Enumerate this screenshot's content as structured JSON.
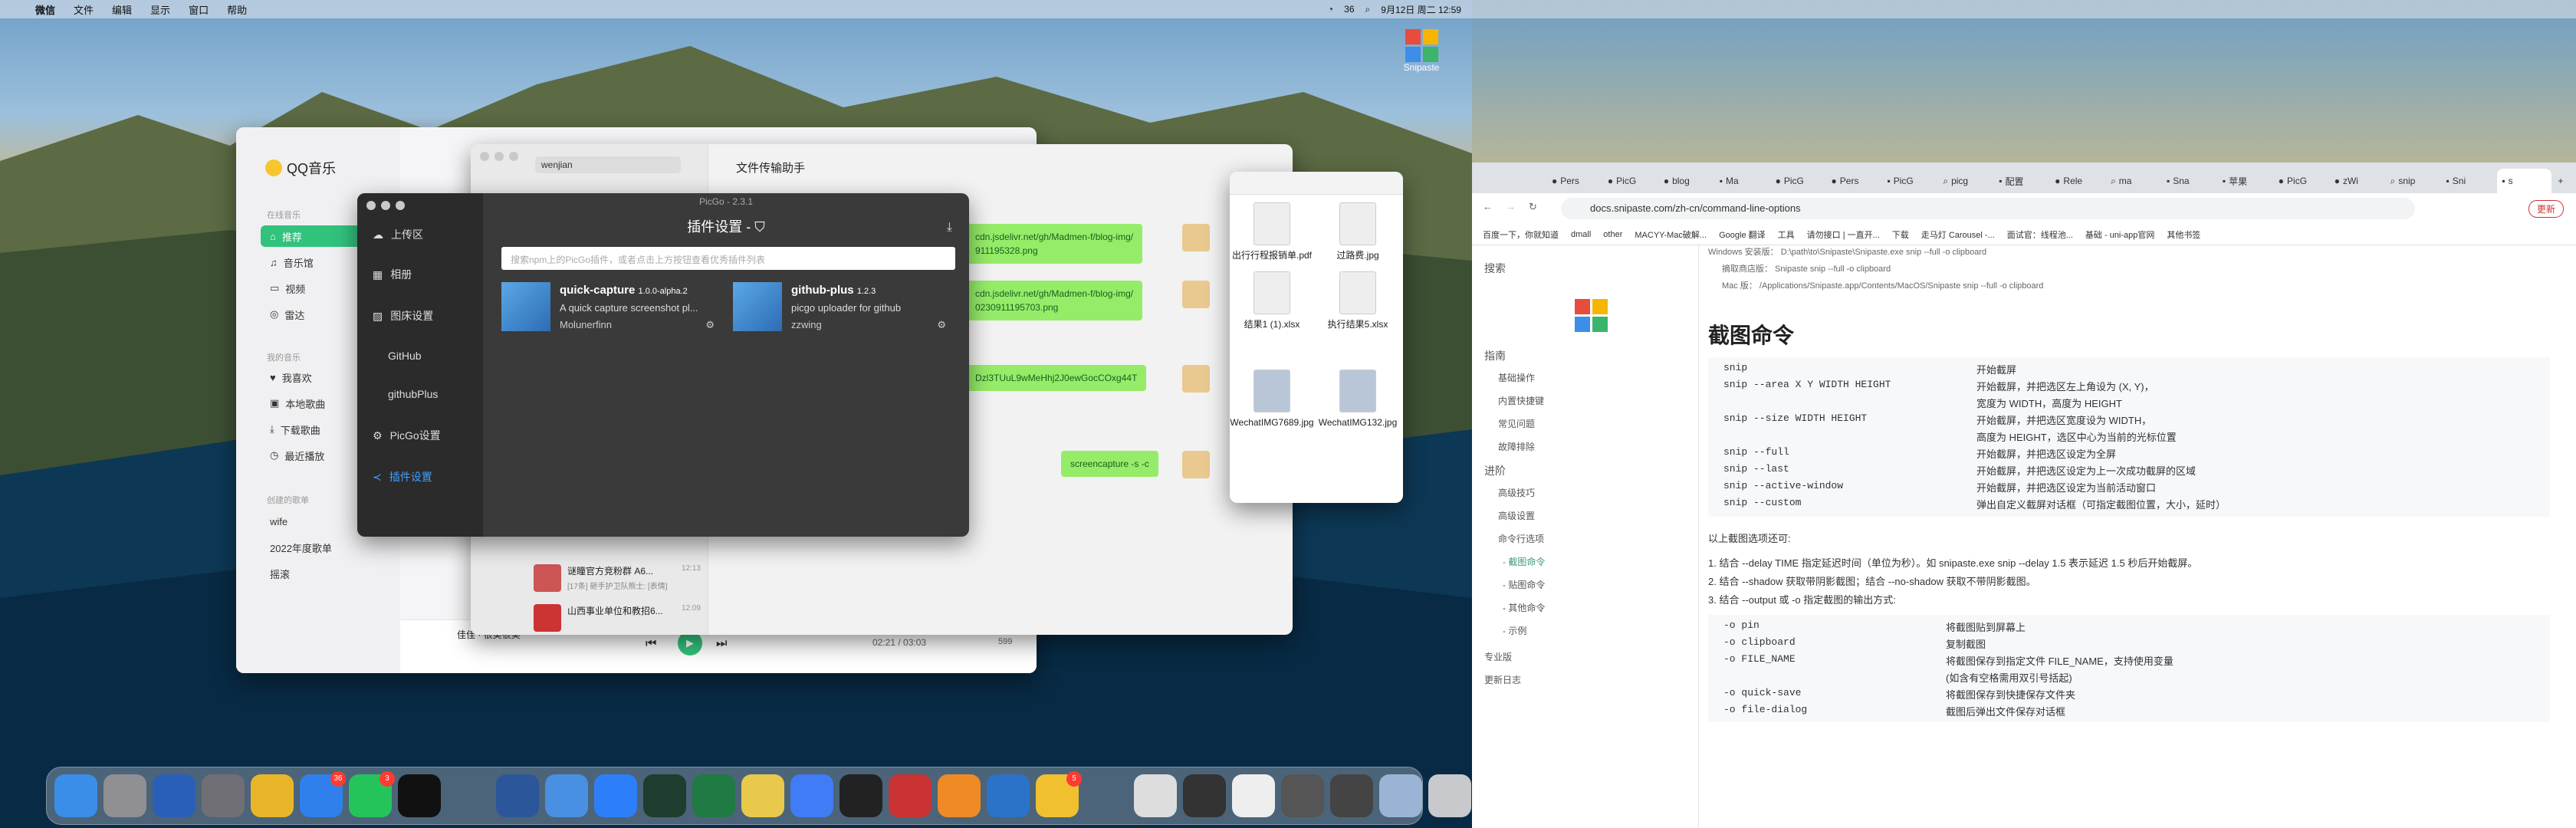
{
  "left_menubar": {
    "app": "微信",
    "items": [
      "文件",
      "编辑",
      "显示",
      "窗口",
      "帮助"
    ],
    "battery": "36",
    "clock": "9月12日 周二 12:59"
  },
  "qq_music": {
    "logo": "QQ音乐",
    "sec_online": "在线音乐",
    "recommend": "推荐",
    "library": "音乐馆",
    "video": "视频",
    "radio": "雷达",
    "sec_mine": "我的音乐",
    "liked": "我喜欢",
    "local": "本地歌曲",
    "downloads": "下载歌曲",
    "recent": "最近播放",
    "sec_created": "创建的歌单",
    "pl1": "wife",
    "pl2": "2022年度歌单",
    "pl3": "摇滚",
    "now_playing": "佳佳 · 很美很美",
    "time": "02:21 / 03:03",
    "count": "599"
  },
  "file_transfer": {
    "title": "文件传输助手",
    "search": "wenjian",
    "msg1": "cdn.jsdelivr.net/gh/Madmen-f/blog-img/\n911195328.png",
    "msg2": "cdn.jsdelivr.net/gh/Madmen-f/blog-img/\n0230911195703.png",
    "msg3": "Dzl3TUuL9wMeHhj2J0ewGocCOxg44T",
    "msg4": "screencapture -s -c",
    "row1": "谜瞳官方竞粉群 A6...",
    "row1sub": "[17条] 砸手护卫队熊士: [表情]",
    "row1time": "12:13",
    "row2": "山西事业单位和教招6...",
    "row2time": "12:09"
  },
  "picgo": {
    "window_title": "PicGo - 2.3.1",
    "nav": [
      "上传区",
      "相册",
      "图床设置",
      "GitHub",
      "githubPlus",
      "PicGo设置",
      "插件设置"
    ],
    "header": "插件设置 -",
    "search_placeholder": "搜索npm上的PicGo插件，或者点击上方按钮查看优秀插件列表",
    "plugins": [
      {
        "name": "quick-capture",
        "version": "1.0.0-alpha.2",
        "desc": "A quick capture screenshot pl...",
        "author": "Molunerfinn"
      },
      {
        "name": "github-plus",
        "version": "1.2.3",
        "desc": "picgo uploader for github",
        "author": "zzwing"
      }
    ]
  },
  "finder": {
    "items": [
      "出行行程报销单.pdf",
      "过路费.jpg",
      "结果1 (1).xlsx",
      "执行结果5.xlsx",
      "WechatIMG7689.jpg",
      "WechatIMG132.jpg"
    ]
  },
  "snipaste_label": "Snipaste",
  "dock_badges": [
    "36",
    "3",
    "5"
  ],
  "browser": {
    "tabs": [
      "Pers",
      "PicG",
      "blog",
      "Ma",
      "PicG",
      "Pers",
      "PicG",
      "picg",
      "配置",
      "Rele",
      "ma",
      "Sna",
      "苹果",
      "PicG",
      "zWi",
      "snip",
      "Sni",
      "s"
    ],
    "url": "docs.snipaste.com/zh-cn/command-line-options",
    "bookmarks": [
      "百度一下，你就知道",
      "dmall",
      "other",
      "MACYY-Mac破解...",
      "Google 翻译",
      "工具",
      "请勿接口 | 一直开...",
      "下载",
      "走马灯 Carousel -...",
      "面试官：线程池...",
      "基础 - uni-app官网",
      "其他书签"
    ],
    "update": "更新"
  },
  "docs": {
    "search": "搜索",
    "nav": [
      "指南",
      "基础操作",
      "内置快捷键",
      "常见问题",
      "故障排除",
      "进阶",
      "高级技巧",
      "高级设置",
      "命令行选项",
      "- 截图命令",
      "- 贴图命令",
      "- 其他命令",
      "- 示例",
      "专业版",
      "更新日志"
    ],
    "top_lines": [
      "Windows 安装版： D:\\path\\to\\Snipaste\\Snipaste.exe snip --full -o clipboard",
      "摘取商店版：  Snipaste snip --full -o clipboard",
      "Mac 版：  /Applications/Snipaste.app/Contents/MacOS/Snipaste snip --full -o clipboard"
    ],
    "h2": "截图命令",
    "cmds": [
      [
        "snip",
        "开始截屏"
      ],
      [
        "snip --area X Y WIDTH HEIGHT",
        "开始截屏，并把选区左上角设为 (X, Y)，"
      ],
      [
        "",
        "宽度为 WIDTH，高度为 HEIGHT"
      ],
      [
        "snip --size WIDTH HEIGHT",
        "开始截屏，并把选区宽度设为 WIDTH，"
      ],
      [
        "",
        "高度为 HEIGHT，选区中心为当前的光标位置"
      ],
      [
        "snip --full",
        "开始截屏，并把选区设定为全屏"
      ],
      [
        "snip --last",
        "开始截屏，并把选区设定为上一次成功截屏的区域"
      ],
      [
        "snip --active-window",
        "开始截屏，并把选区设定为当前活动窗口"
      ],
      [
        "snip --custom",
        "弹出自定义截屏对话框（可指定截图位置，大小，延时）"
      ]
    ],
    "intro": "以上截图选项还可:",
    "list": [
      "1. 结合 --delay TIME 指定延迟时间（单位为秒）。如 snipaste.exe snip --delay 1.5 表示延迟 1.5 秒后开始截屏。",
      "2. 结合 --shadow 获取带阴影截图；结合 --no-shadow 获取不带阴影截图。",
      "3. 结合 --output 或 -o 指定截图的输出方式:"
    ],
    "out": [
      [
        "-o pin",
        "将截图贴到屏幕上"
      ],
      [
        "-o clipboard",
        "复制截图"
      ],
      [
        "-o FILE_NAME",
        "将截图保存到指定文件 FILE_NAME，支持使用变量"
      ],
      [
        "",
        "(如含有空格需用双引号括起)"
      ],
      [
        "-o quick-save",
        "将截图保存到快捷保存文件夹"
      ],
      [
        "-o file-dialog",
        "截图后弹出文件保存对话框"
      ]
    ]
  }
}
